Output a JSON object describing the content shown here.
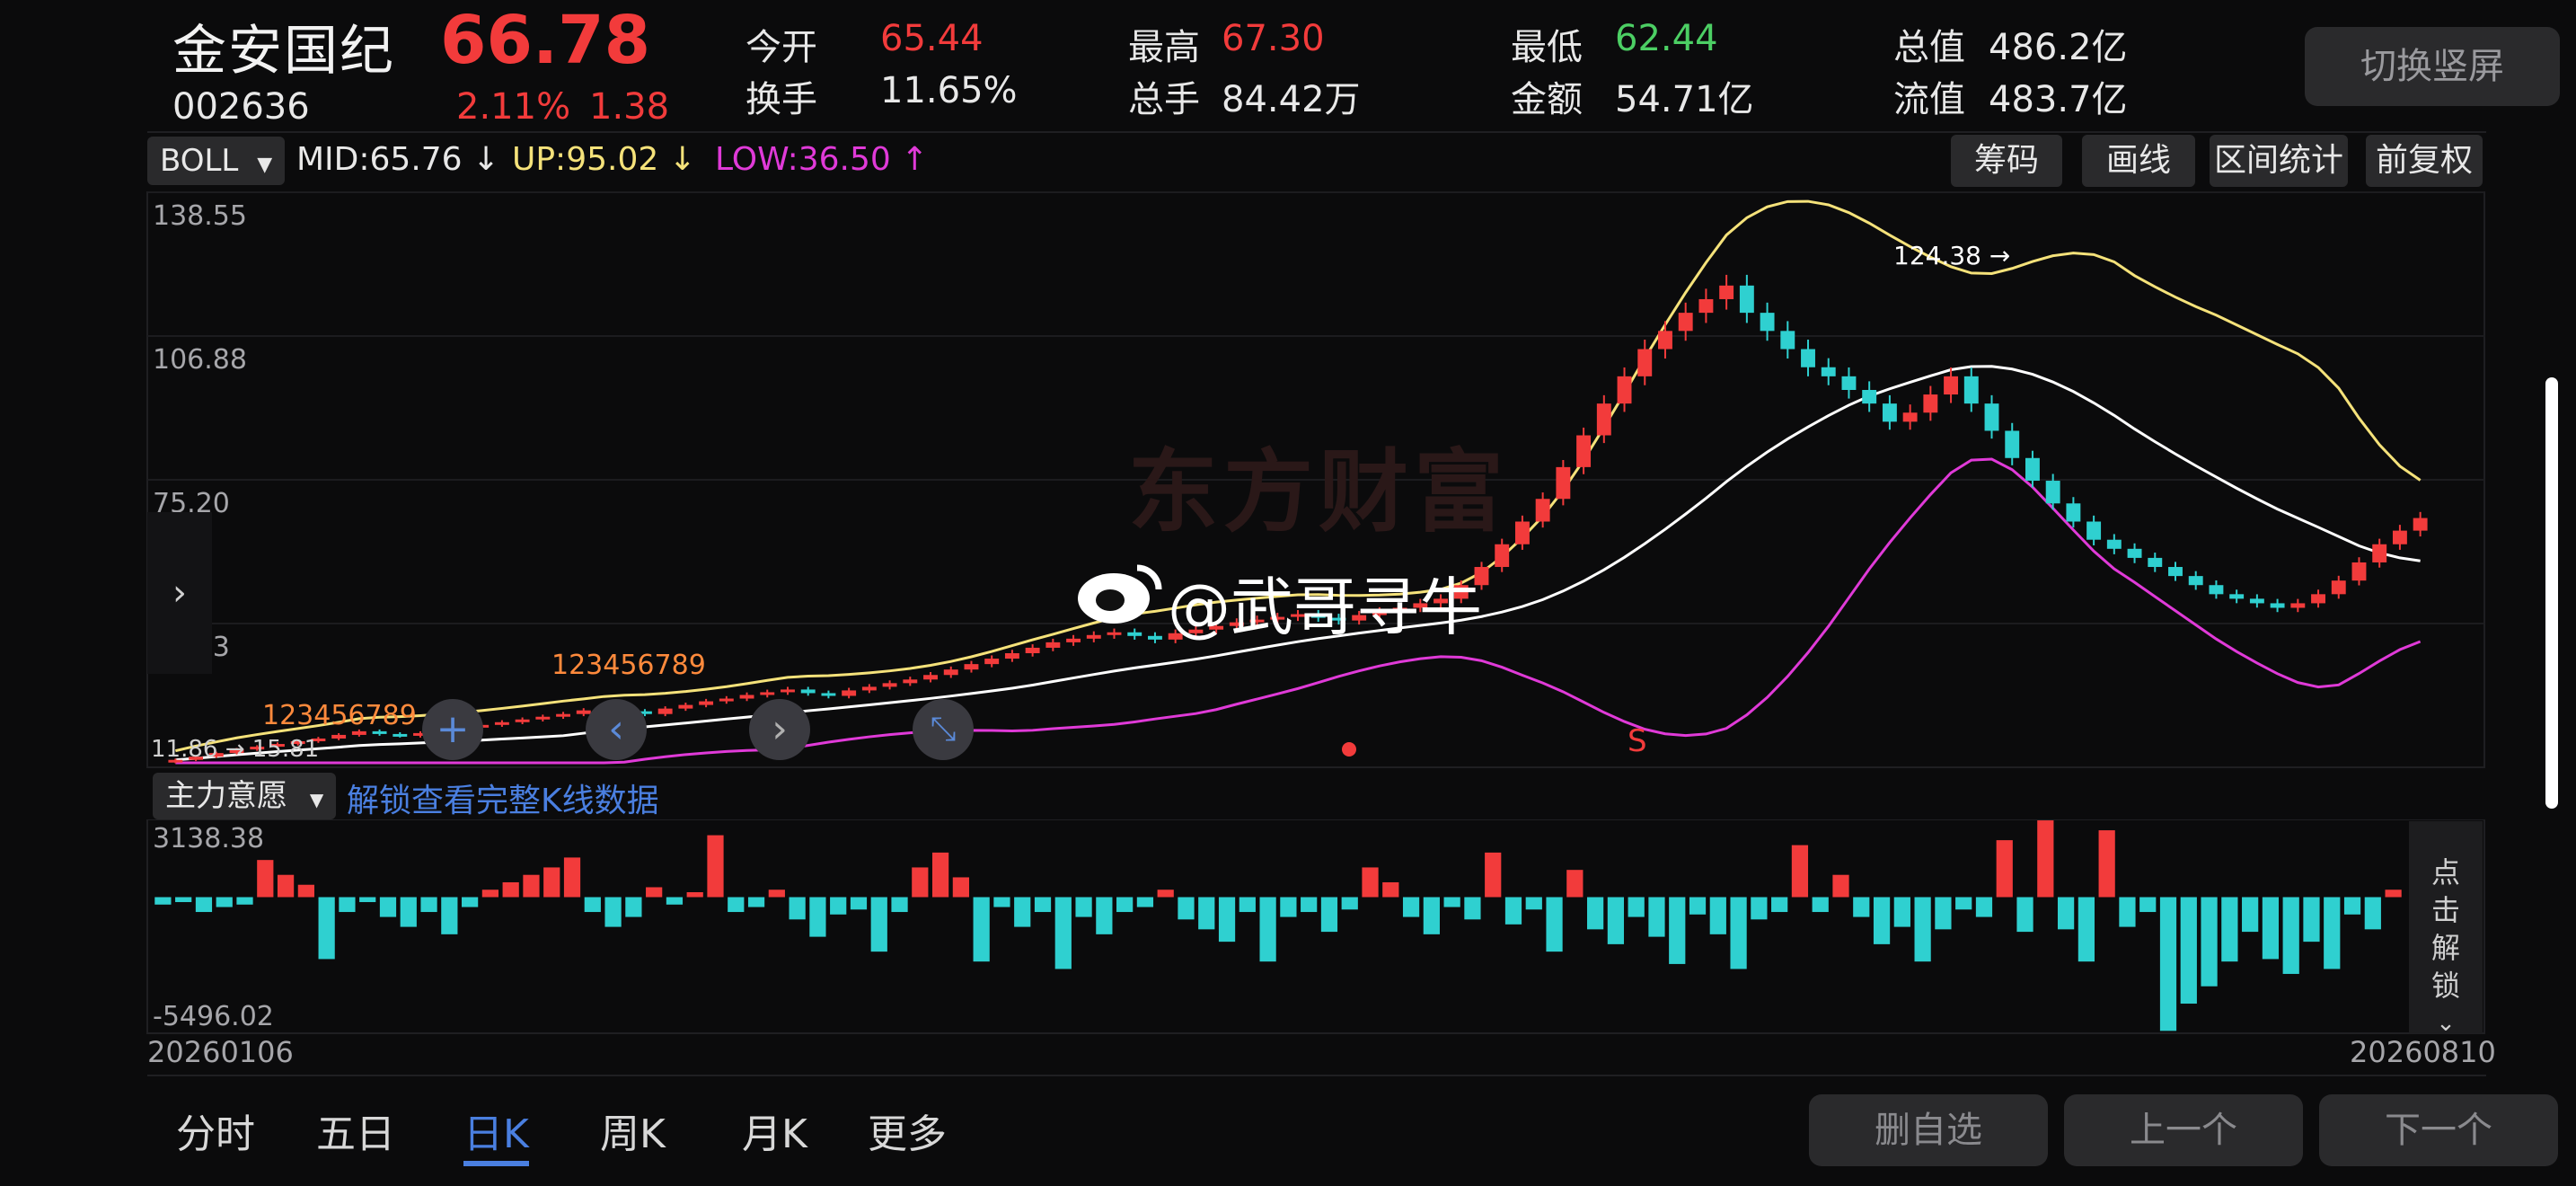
{
  "quote": {
    "name": "金安国纪",
    "price": "66.78",
    "code": "002636",
    "change_pct": "2.11%",
    "change": "1.38",
    "fields": [
      {
        "label": "今开",
        "value": "65.44",
        "color": "red"
      },
      {
        "label": "最高",
        "value": "67.30",
        "color": "red"
      },
      {
        "label": "最低",
        "value": "62.44",
        "color": "green"
      },
      {
        "label": "总值",
        "value": "486.2亿",
        "color": "white"
      },
      {
        "label": "换手",
        "value": "11.65%",
        "color": "white"
      },
      {
        "label": "总手",
        "value": "84.42万",
        "color": "white"
      },
      {
        "label": "金额",
        "value": "54.71亿",
        "color": "white"
      },
      {
        "label": "流值",
        "value": "483.7亿",
        "color": "white"
      }
    ]
  },
  "toolbar": {
    "rotate_label": "切换竖屏",
    "indicator_select": "BOLL",
    "mid": "MID:65.76",
    "up": "UP:95.02",
    "low": "LOW:36.50",
    "buttons": [
      "筹码",
      "画线",
      "区间统计",
      "前复权"
    ]
  },
  "main_chart": {
    "y_ticks": [
      "138.55",
      "106.88",
      "75.20",
      "43.53"
    ],
    "peak_label": "124.38",
    "min_label": "11.86",
    "min_label2": "15.81",
    "watermark": "东方财富",
    "credit": "@武哥寻牛",
    "sell_mark": "S",
    "setup_counts_1": "123456789",
    "setup_counts_2": "123456789"
  },
  "sub_chart": {
    "indicator_select": "主力意愿",
    "unlock_link": "解锁查看完整K线数据",
    "y_max": "3138.38",
    "y_min": "-5496.02",
    "date_start": "20260106",
    "date_end": "20260810",
    "unlock_side": "点击解锁"
  },
  "bottom": {
    "tabs": [
      "分时",
      "五日",
      "日K",
      "周K",
      "月K",
      "更多"
    ],
    "active_tab": "日K",
    "buttons": [
      "删自选",
      "上一个",
      "下一个"
    ]
  },
  "colors": {
    "up": "#f23b3b",
    "down": "#2fd0d0",
    "mid": "#ffffff",
    "upper": "#f5e27a",
    "lower": "#e03ad8",
    "accent": "#4a7fe0"
  },
  "chart_data": {
    "type": "candlestick",
    "closes": [
      13.5,
      14.2,
      15.0,
      15.8,
      16.4,
      17.0,
      17.6,
      18.2,
      19.0,
      19.8,
      19.2,
      18.8,
      19.4,
      20.0,
      20.6,
      21.2,
      21.8,
      22.4,
      23.0,
      23.6,
      24.4,
      25.0,
      24.2,
      23.6,
      24.8,
      25.6,
      26.4,
      27.0,
      27.8,
      28.4,
      29.0,
      28.2,
      27.6,
      28.8,
      29.6,
      30.4,
      31.2,
      32.2,
      33.4,
      34.6,
      35.8,
      37.0,
      38.2,
      39.4,
      40.2,
      41.0,
      41.6,
      40.8,
      40.0,
      41.4,
      42.2,
      43.0,
      43.8,
      44.4,
      45.0,
      45.6,
      44.8,
      44.2,
      45.4,
      46.2,
      47.0,
      48.0,
      49.0,
      52.0,
      56.0,
      61.0,
      66.0,
      71.0,
      78.0,
      85.0,
      92.0,
      98.0,
      104.0,
      108.0,
      112.0,
      115.0,
      118.0,
      112.0,
      108.0,
      104.0,
      100.0,
      98.0,
      95.0,
      92.0,
      88.0,
      90.0,
      94.0,
      98.0,
      92.0,
      86.0,
      80.0,
      75.0,
      70.0,
      66.0,
      62.0,
      60.0,
      58.0,
      56.0,
      54.0,
      52.0,
      50.0,
      49.0,
      48.0,
      47.0,
      48.0,
      50.0,
      53.0,
      57.0,
      61.0,
      64.0,
      66.78
    ],
    "flow_values": [
      -300,
      -200,
      -600,
      -400,
      -300,
      1500,
      900,
      500,
      -2500,
      -600,
      -200,
      -800,
      -1200,
      -600,
      -1500,
      -400,
      300,
      600,
      900,
      1200,
      1600,
      -600,
      -1200,
      -800,
      400,
      -300,
      200,
      2500,
      -600,
      -400,
      300,
      -900,
      -1600,
      -700,
      -500,
      -2200,
      -600,
      1200,
      1800,
      800,
      -2600,
      -400,
      -1200,
      -600,
      -2900,
      -800,
      -1500,
      -600,
      -400,
      300,
      -900,
      -1300,
      -1800,
      -600,
      -2600,
      -800,
      -600,
      -1400,
      -500,
      1200,
      600,
      -800,
      -1500,
      -400,
      -900,
      1800,
      -1100,
      -500,
      -2200,
      1100,
      -1300,
      -1900,
      -800,
      -1600,
      -2700,
      -700,
      -1500,
      -2900,
      -900,
      -600,
      2100,
      -600,
      900,
      -800,
      -1900,
      -1200,
      -2600,
      -1300,
      -500,
      -800,
      2300,
      -1400,
      3100,
      -1300,
      -2600,
      2700,
      -1200,
      -600,
      -5400,
      -4300,
      -3600,
      -2600,
      -1400,
      -2500,
      -3100,
      -1800,
      -2900,
      -700,
      -1300,
      300
    ],
    "upper_band": "yellow",
    "mid_band": "white",
    "lower_band": "magenta"
  }
}
